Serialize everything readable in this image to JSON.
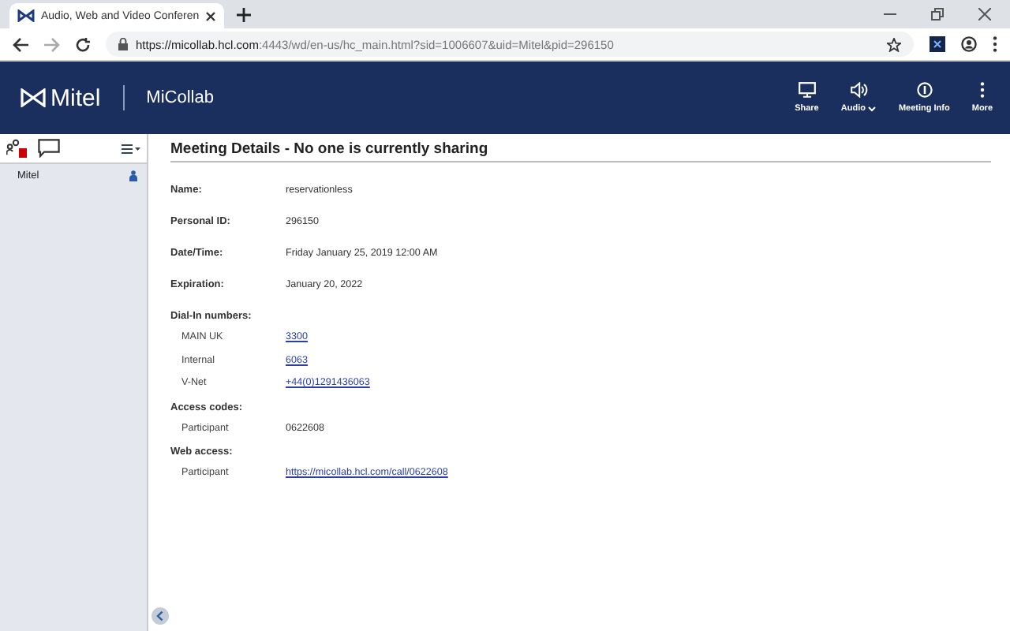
{
  "browser": {
    "tab_title": "Audio, Web and Video Conferen",
    "url_host": "https://micollab.hcl.com",
    "url_rest": ":4443/wd/en-us/hc_main.html?sid=1006607&uid=Mitel&pid=296150"
  },
  "header": {
    "logo": "Mitel",
    "product": "MiCollab",
    "actions": [
      {
        "label": "Share",
        "kind": "share"
      },
      {
        "label": "Audio",
        "kind": "audio"
      },
      {
        "label": "Meeting Info",
        "kind": "info"
      },
      {
        "label": "More",
        "kind": "more"
      }
    ]
  },
  "sidebar": {
    "participants": [
      {
        "name": "Mitel"
      }
    ]
  },
  "details": {
    "title": "Meeting Details - No one is currently sharing",
    "fields": [
      {
        "kind": "field",
        "label": "Name:",
        "value": "reservationless"
      },
      {
        "kind": "field",
        "label": "Personal ID:",
        "value": "296150"
      },
      {
        "kind": "field",
        "label": "Date/Time:",
        "value": "Friday January 25, 2019 12:00 AM"
      },
      {
        "kind": "field",
        "label": "Expiration:",
        "value": "January 20, 2022"
      },
      {
        "kind": "group",
        "label": "Dial-In numbers:",
        "rows": [
          {
            "label": "MAIN UK",
            "value": "3300",
            "link": true
          },
          {
            "label": "Internal",
            "value": "6063",
            "link": true
          },
          {
            "label": "V-Net",
            "value": "+44(0)1291436063",
            "link": true
          }
        ]
      },
      {
        "kind": "group",
        "label": "Access codes:",
        "rows": [
          {
            "label": "Participant",
            "value": "0622608",
            "link": false
          }
        ]
      },
      {
        "kind": "group",
        "label": "Web access:",
        "rows": [
          {
            "label": "Participant",
            "value": "https://micollab.hcl.com/call/0622608",
            "link": true
          }
        ]
      }
    ]
  }
}
